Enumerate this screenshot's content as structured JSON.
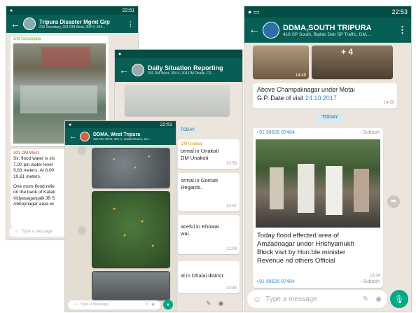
{
  "p1": {
    "title": "Tripura Disaster Mgmt Grp",
    "subtitle": "212 Secretary, 301 DM West, 304 4, 304...",
    "time": "22:51",
    "sender_top": "DM Sepahijala",
    "sender_mid": "301 DM West",
    "text_a": "Sir, flood water is slo",
    "text_b": "7.00 pm water level",
    "text_c": "9.83 meters. At 6.00",
    "text_d": "10.61 meters.",
    "text_e": "One more flood relie",
    "text_f": "on the bank of Katak",
    "text_g": "Vidyasagarpalli JB S",
    "text_h": "Abhoynagar area wi",
    "input_placeholder": "Type a message"
  },
  "p2": {
    "title": "Daily Situation Reporting",
    "subtitle": "301 DM West, 304 4, 304 DM Dhalai, CS",
    "time": "",
    "chip": "TODAY",
    "sender": "DM Unakoti",
    "m1a": "ormal in Unakoti",
    "m1b": "DM Unakoti",
    "m1ts": "10:56",
    "m2a": "ormal in Gomati",
    "m2b": "Regards.",
    "m2ts": "10:57",
    "m3a": "aceful in Khowai",
    "m3b": "wai.",
    "m3ts": "11:04",
    "m4a": "al in Dhalai district.",
    "m4ts": "13:45"
  },
  "p3": {
    "title": "DDMA, West Tripura",
    "subtitle": "301 DM West, 304 4, Sadar/Jirania, Mo...",
    "time": "22:51",
    "input_placeholder": "Type a message"
  },
  "p4": {
    "title": "DDMA,SOUTH TRIPURA",
    "subtitle": "418 SP South, Biplab Deb SP Traffic, DM,...",
    "time": "22:53",
    "plus_count": "+ 4",
    "img_ts": "14:49",
    "msg1a": "Above Champaknagar under Motai",
    "msg1b": "G.P. Date of visit",
    "msg1_date": "24.10.2017",
    "msg1_ts": "14:50",
    "chip": "TODAY",
    "phone1": "+91 98626 87484",
    "sender1": "~Subash",
    "caption_a": "Today flood effected area of",
    "caption_b": "Amzadnagar under Hrishyamukh",
    "caption_c": "Block visit by Hon.ble minister",
    "caption_d": "Revenue nd others Official",
    "caption_ts": "18:24",
    "phone2": "+91 98626 87484",
    "sender2": "~Subash",
    "input_placeholder": "Type a message"
  },
  "colors": {
    "header": "#075e54",
    "statusbar": "#054d44",
    "chat_bg": "#ece5dd",
    "accent": "#00a884",
    "link": "#3a8ed6"
  },
  "icons": [
    "back-arrow-icon",
    "menu-dots-icon",
    "mic-icon",
    "emoji-icon",
    "attach-icon",
    "camera-icon",
    "forward-icon"
  ]
}
